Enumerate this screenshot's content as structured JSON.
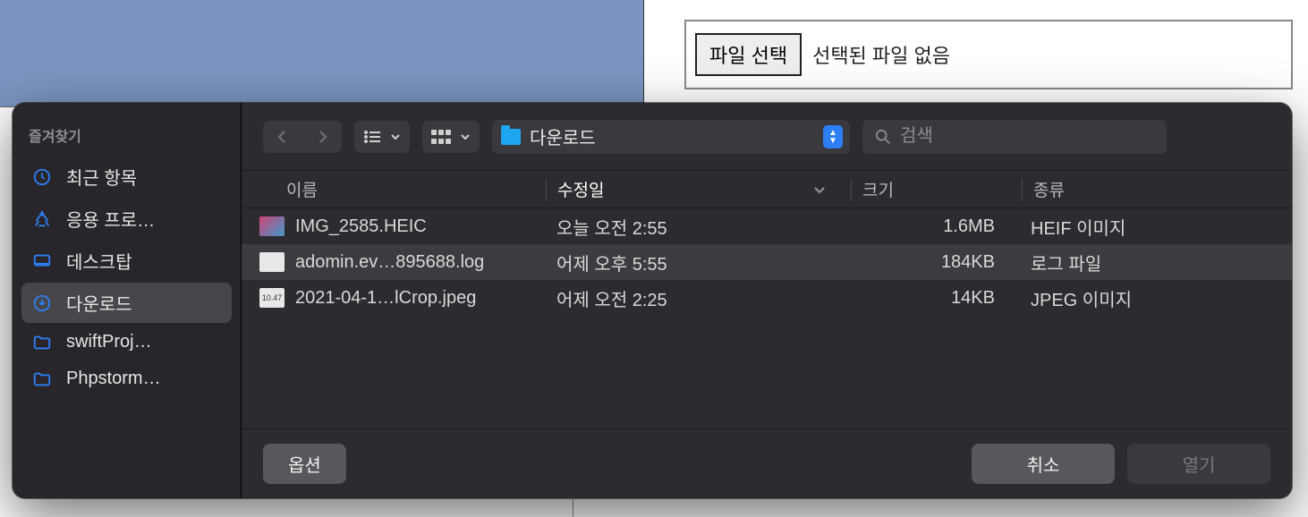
{
  "upload_bar": {
    "button_label": "파일 선택",
    "status_text": "선택된 파일 없음"
  },
  "sidebar": {
    "heading": "즐겨찾기",
    "items": [
      {
        "icon": "clock-icon",
        "label": "최근 항목"
      },
      {
        "icon": "apps-icon",
        "label": "응용 프로…"
      },
      {
        "icon": "desktop-icon",
        "label": "데스크탑"
      },
      {
        "icon": "download-icon",
        "label": "다운로드",
        "selected": true
      },
      {
        "icon": "folder-icon",
        "label": "swiftProj…"
      },
      {
        "icon": "folder-icon",
        "label": "Phpstorm…"
      }
    ]
  },
  "toolbar": {
    "location": "다운로드",
    "search_placeholder": "검색"
  },
  "columns": {
    "name": "이름",
    "modified": "수정일",
    "size": "크기",
    "kind": "종류"
  },
  "files": [
    {
      "name": "IMG_2585.HEIC",
      "modified": "오늘 오전 2:55",
      "size": "1.6MB",
      "kind": "HEIF 이미지",
      "icon": "thumb"
    },
    {
      "name": "adomin.ev…895688.log",
      "modified": "어제 오후 5:55",
      "size": "184KB",
      "kind": "로그 파일",
      "icon": "doc",
      "selected": true
    },
    {
      "name": "2021-04-1…lCrop.jpeg",
      "modified": "어제 오전 2:25",
      "size": "14KB",
      "kind": "JPEG 이미지",
      "icon": "doc"
    }
  ],
  "footer": {
    "options": "옵션",
    "cancel": "취소",
    "open": "열기"
  }
}
